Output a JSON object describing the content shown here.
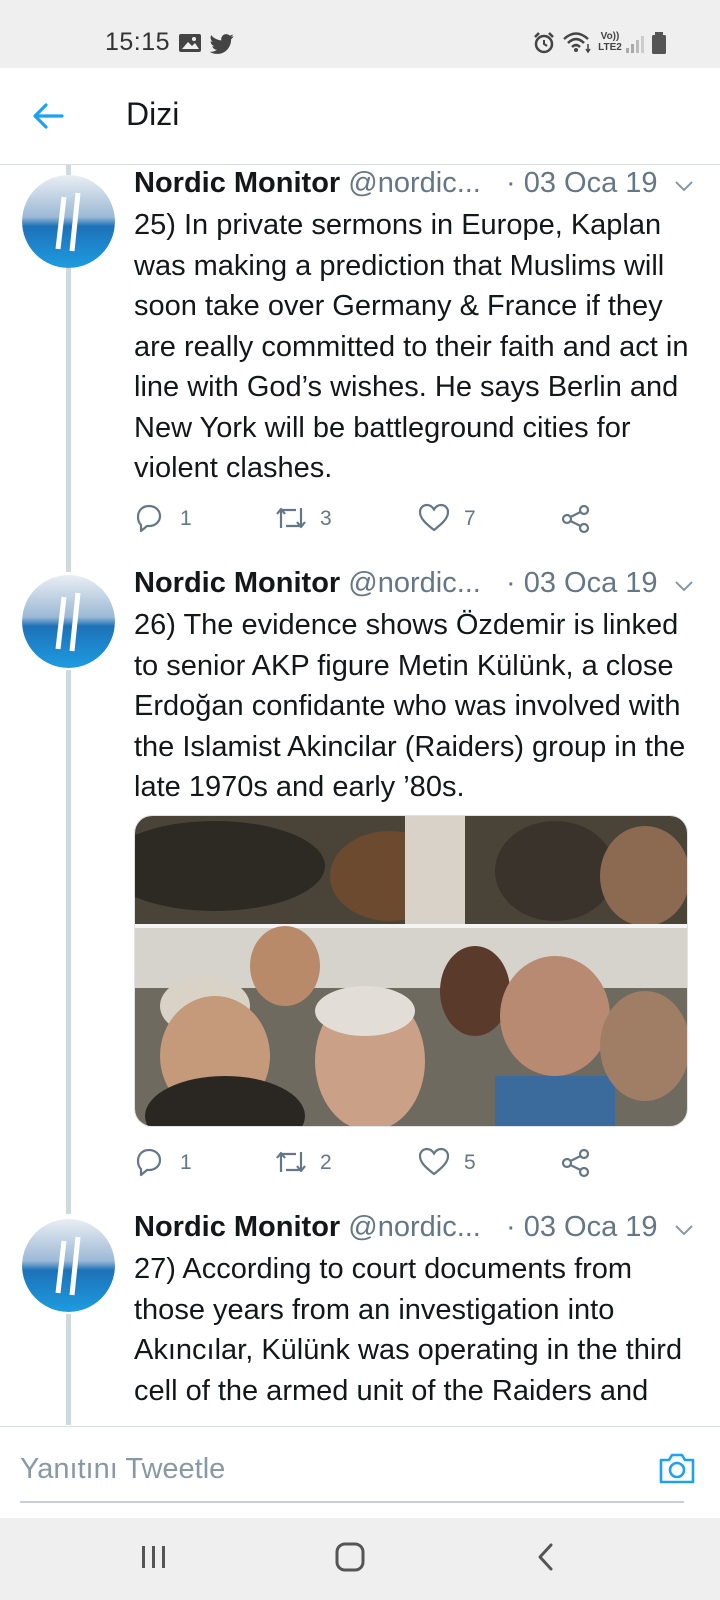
{
  "status_bar": {
    "time": "15:15",
    "icons": [
      "image-icon",
      "twitter-icon",
      "alarm-icon",
      "wifi-icon",
      "volte-icon",
      "signal-icon",
      "battery-icon"
    ],
    "volte_label_top": "Vo))",
    "volte_label_bottom": "LTE2"
  },
  "header": {
    "title": "Dizi",
    "back_icon": "arrow-left-icon"
  },
  "colors": {
    "accent": "#1da1f2",
    "text": "#14171a",
    "secondary": "#657786",
    "thread_line": "#cfd9de"
  },
  "tweets": [
    {
      "author": "Nordic Monitor",
      "handle": "@nordic...",
      "date": "· 03 Oca 19",
      "text": "25) In private sermons in Europe, Kaplan was making a prediction that Muslims will soon take over Germany & France if they are really committed to their faith and act in line with God’s wishes. He says Berlin and New York will be battleground cities for violent clashes.",
      "replies": "1",
      "retweets": "3",
      "likes": "7"
    },
    {
      "author": "Nordic Monitor",
      "handle": "@nordic...",
      "date": "· 03 Oca 19",
      "text": "26) The evidence shows Özdemir is linked to senior AKP figure Metin Külünk, a close Erdoğan confidante who was involved with the Islamist Akincilar (Raiders) group in the late 1970s and early ’80s.",
      "replies": "1",
      "retweets": "2",
      "likes": "5",
      "has_media": true
    },
    {
      "author": "Nordic Monitor",
      "handle": "@nordic...",
      "date": "· 03 Oca 19",
      "text": "27) According to court documents from those years from an investigation into Akıncılar, Külünk was operating in the third cell of the armed unit of the Raiders and"
    }
  ],
  "reply_bar": {
    "placeholder": "Yanıtını Tweetle",
    "camera_icon": "camera-icon"
  },
  "nav_bar": {
    "buttons": [
      "recents-icon",
      "home-icon",
      "back-icon"
    ]
  }
}
